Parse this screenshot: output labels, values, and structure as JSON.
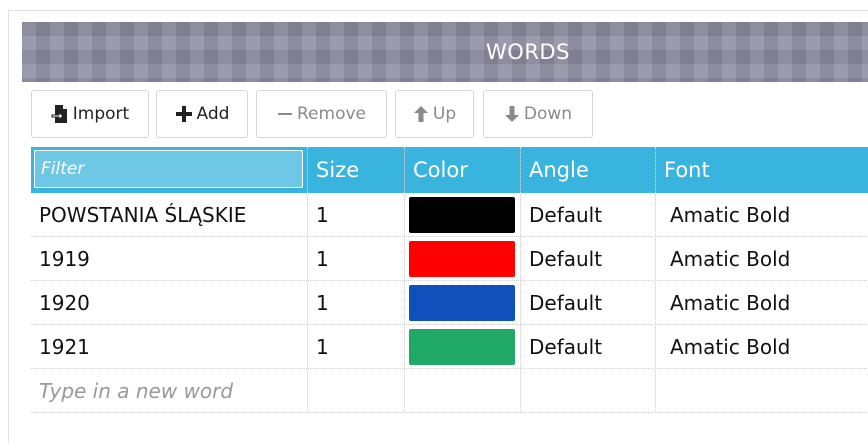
{
  "panel": {
    "title": "WORDS"
  },
  "toolbar": {
    "import_label": "Import",
    "add_label": "Add",
    "remove_label": "Remove",
    "up_label": "Up",
    "down_label": "Down"
  },
  "grid": {
    "filter_placeholder": "Filter",
    "columns": {
      "size": "Size",
      "color": "Color",
      "angle": "Angle",
      "font": "Font"
    },
    "rows": [
      {
        "word": "POWSTANIA ŚLĄSKIE",
        "size": "1",
        "color": "#000000",
        "angle": "Default",
        "font": "Amatic Bold"
      },
      {
        "word": "1919",
        "size": "1",
        "color": "#ff0000",
        "angle": "Default",
        "font": "Amatic Bold"
      },
      {
        "word": "1920",
        "size": "1",
        "color": "#1150bb",
        "angle": "Default",
        "font": "Amatic Bold"
      },
      {
        "word": "1921",
        "size": "1",
        "color": "#20a867",
        "angle": "Default",
        "font": "Amatic Bold"
      }
    ],
    "new_word_placeholder": "Type in a new word"
  },
  "colors": {
    "header_bg": "#8c8ba0",
    "grid_header": "#39b4de"
  },
  "icons": {
    "import": "import-icon",
    "add": "plus-icon",
    "remove": "minus-icon",
    "up": "arrow-up-icon",
    "down": "arrow-down-icon",
    "font_dropdown": "caret-down-icon"
  }
}
